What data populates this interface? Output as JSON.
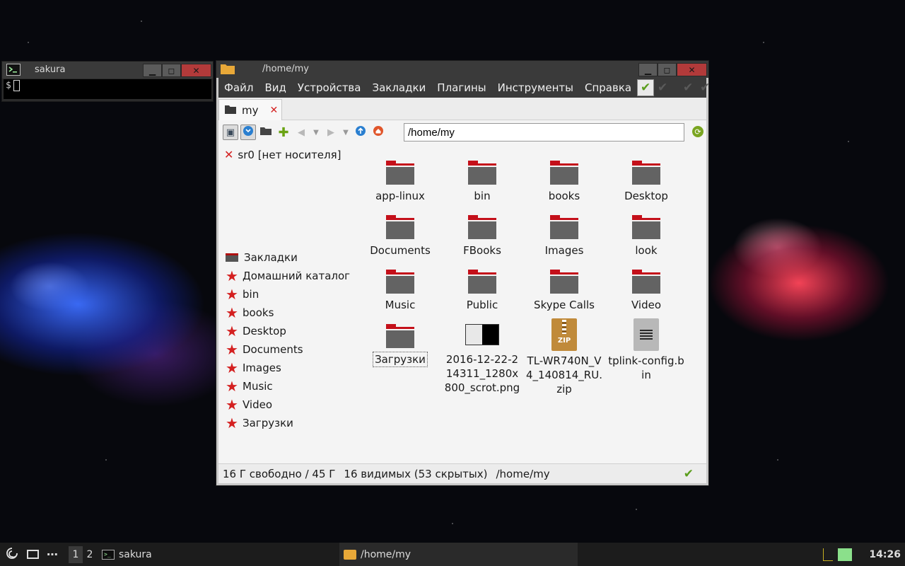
{
  "terminal": {
    "title": "sakura",
    "prompt": "$"
  },
  "file_manager": {
    "title": "/home/my",
    "menu": [
      "Файл",
      "Вид",
      "Устройства",
      "Закладки",
      "Плагины",
      "Инструменты",
      "Справка"
    ],
    "tab_label": "my",
    "path": "/home/my",
    "device": "sr0 [нет носителя]",
    "bookmarks_header": "Закладки",
    "bookmarks": [
      "Домашний каталог",
      "bin",
      "books",
      "Desktop",
      "Documents",
      "Images",
      "Music",
      "Video",
      "Загрузки"
    ],
    "items": [
      {
        "name": "app-linux",
        "type": "folder"
      },
      {
        "name": "bin",
        "type": "folder"
      },
      {
        "name": "books",
        "type": "folder"
      },
      {
        "name": "Desktop",
        "type": "folder"
      },
      {
        "name": "Documents",
        "type": "folder"
      },
      {
        "name": "FBooks",
        "type": "folder"
      },
      {
        "name": "Images",
        "type": "folder"
      },
      {
        "name": "look",
        "type": "folder"
      },
      {
        "name": "Music",
        "type": "folder"
      },
      {
        "name": "Public",
        "type": "folder"
      },
      {
        "name": "Skype Calls",
        "type": "folder"
      },
      {
        "name": "Video",
        "type": "folder"
      },
      {
        "name": "Загрузки",
        "type": "folder",
        "focused": true
      },
      {
        "name": "2016-12-22-214311_1280x800_scrot.png",
        "type": "image"
      },
      {
        "name": "TL-WR740N_V4_140814_RU.zip",
        "type": "zip"
      },
      {
        "name": "tplink-config.bin",
        "type": "file"
      }
    ],
    "status": {
      "free": "16 Г свободно / 45 Г",
      "count": "16 видимых (53 скрытых)",
      "path": "/home/my"
    },
    "icons": {
      "ok": "check-icon",
      "close_tab": "close-icon"
    }
  },
  "taskbar": {
    "desktops": [
      "1",
      "2"
    ],
    "tasks": [
      {
        "label": "sakura",
        "icon": "terminal-icon"
      },
      {
        "label": "/home/my",
        "icon": "folder-icon"
      }
    ],
    "clock": "14:26"
  },
  "colors": {
    "accent_red": "#c4101a",
    "ok_green": "#5a9d1c"
  }
}
